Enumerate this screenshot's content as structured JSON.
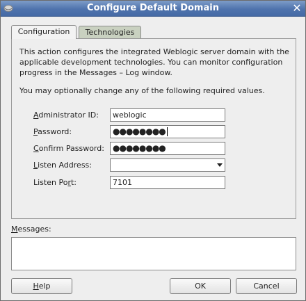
{
  "window": {
    "title": "Configure Default Domain",
    "close_glyph": "✕"
  },
  "tabs": [
    {
      "label": "Configuration",
      "selected": true
    },
    {
      "label": "Technologies",
      "selected": false
    }
  ],
  "description": {
    "paragraph1": "This action configures the integrated Weblogic server domain with the applicable development technologies.  You can monitor configuration progress in the Messages – Log window.",
    "paragraph2": "You may optionally change any of the following required values."
  },
  "form": {
    "admin_id": {
      "label_mnemonic": "A",
      "label_rest": "dministrator ID:",
      "value": "weblogic"
    },
    "password": {
      "label_mnemonic": "P",
      "label_rest": "assword:",
      "value": "●●●●●●●●"
    },
    "confirm_password": {
      "label_mnemonic": "C",
      "label_rest": "onfirm Password:",
      "value": "●●●●●●●●"
    },
    "listen_address": {
      "label_mnemonic": "L",
      "label_rest": "isten Address:",
      "value": ""
    },
    "listen_port": {
      "label_before": "Listen Po",
      "label_mnemonic": "r",
      "label_after": "t:",
      "value": "7101"
    }
  },
  "messages": {
    "label_mnemonic": "M",
    "label_rest": "essages:"
  },
  "buttons": {
    "help": {
      "mnemonic": "H",
      "rest": "elp"
    },
    "ok": "OK",
    "cancel": "Cancel"
  }
}
